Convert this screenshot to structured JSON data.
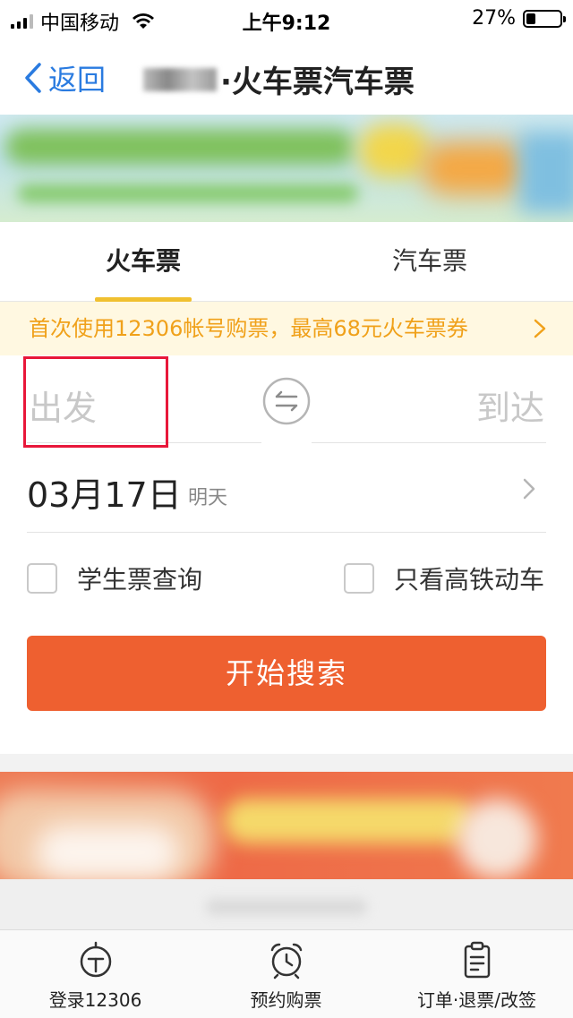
{
  "status_bar": {
    "carrier": "中国移动",
    "time": "上午9:12",
    "battery": "27%"
  },
  "nav": {
    "back_label": "返回",
    "title": "·火车票汽车票"
  },
  "tabs": [
    {
      "label": "火车票"
    },
    {
      "label": "汽车票"
    }
  ],
  "promo": {
    "text": "首次使用12306帐号购票，最高68元火车票券"
  },
  "stations": {
    "from_placeholder": "出发",
    "to_placeholder": "到达"
  },
  "date": {
    "value": "03月17日",
    "relative": "明天"
  },
  "options": {
    "student": "学生票查询",
    "high_speed_only": "只看高铁动车"
  },
  "search_button": "开始搜索",
  "tabbar": [
    {
      "label": "登录12306"
    },
    {
      "label": "预约购票"
    },
    {
      "label": "订单·退票/改签"
    }
  ],
  "colors": {
    "accent_orange": "#ee6030",
    "link_blue": "#2a7be0",
    "promo_text": "#f0a11a",
    "tab_underline": "#f0c030",
    "highlight_red": "#e8173a"
  }
}
